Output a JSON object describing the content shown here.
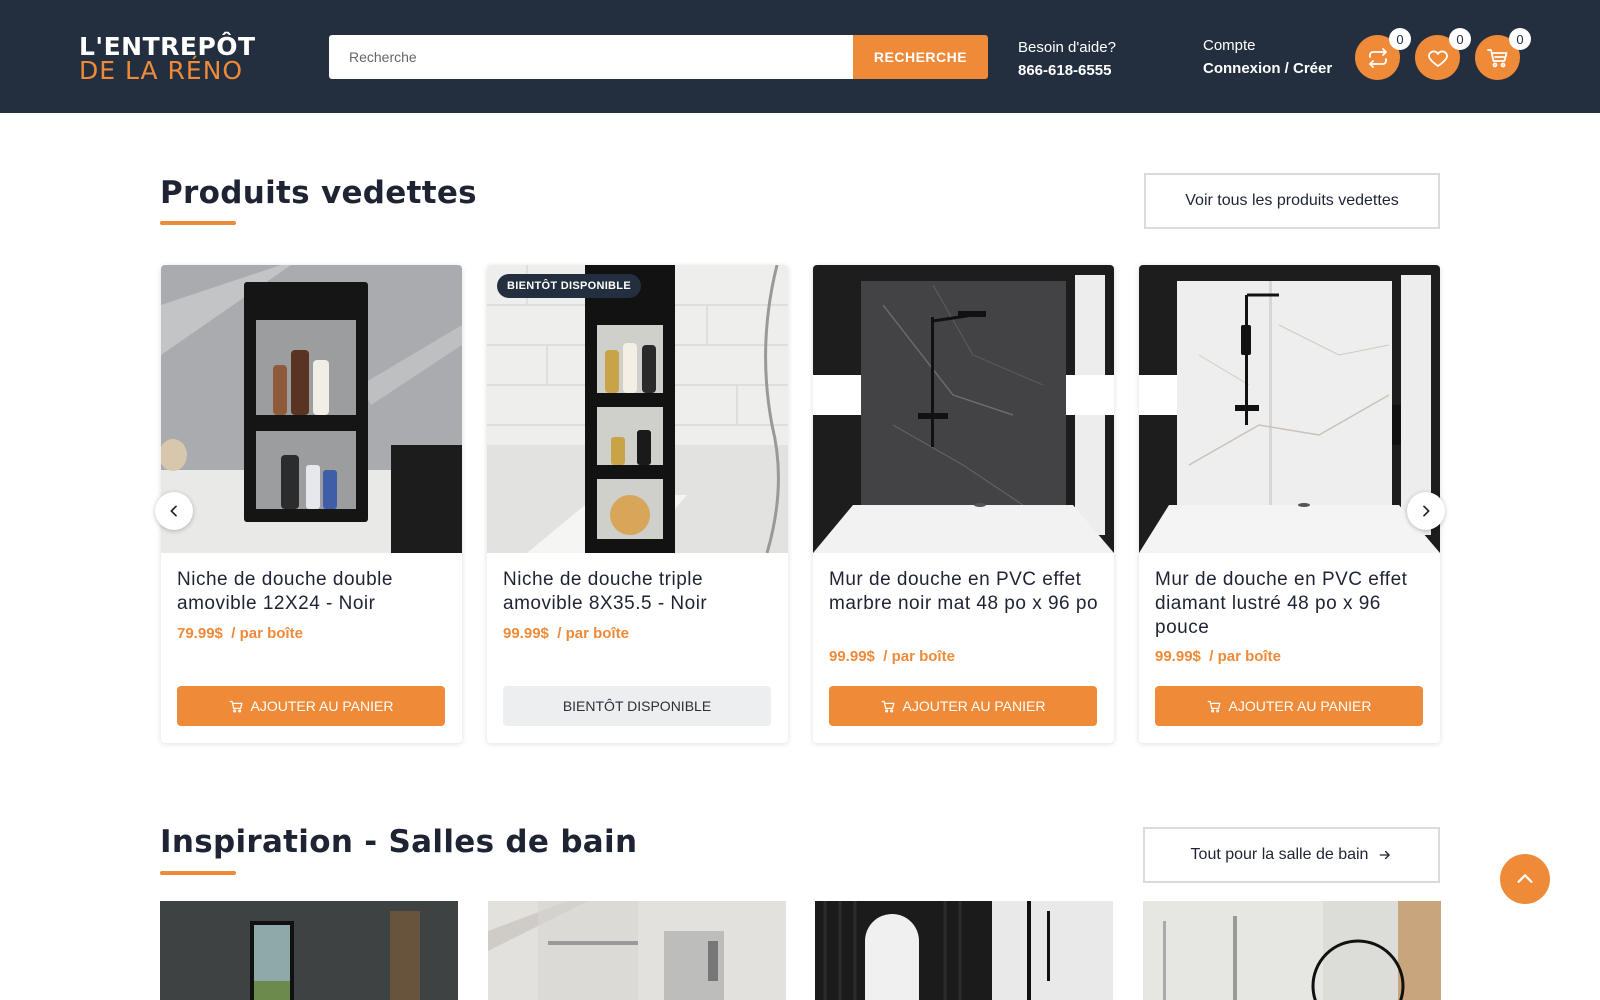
{
  "header": {
    "logo_line1": "L'ENTREPÔT",
    "logo_line2": "DE LA RÉNO",
    "search_placeholder": "Recherche",
    "search_button": "RECHERCHE",
    "help_label": "Besoin d'aide?",
    "help_phone": "866-618-6555",
    "account_label": "Compte",
    "account_links": "Connexion / Créer",
    "compare_count": "0",
    "wishlist_count": "0",
    "cart_count": "0",
    "accent_color": "#ef8a38",
    "bg_color": "#232f3e"
  },
  "featured": {
    "title": "Produits vedettes",
    "view_all": "Voir tous les produits vedettes",
    "products": [
      {
        "name": "Niche de douche double amovible 12X24 - Noir",
        "price": "79.99$",
        "unit": "/ par boîte",
        "button": "AJOUTER AU PANIER",
        "badge": ""
      },
      {
        "name": "Niche de douche triple amovible 8X35.5 - Noir",
        "price": "99.99$",
        "unit": "/ par boîte",
        "button": "BIENTÔT DISPONIBLE",
        "badge": "BIENTÔT DISPONIBLE"
      },
      {
        "name": "Mur de douche en PVC effet marbre noir mat 48 po x 96 po",
        "price": "99.99$",
        "unit": "/ par boîte",
        "button": "AJOUTER AU PANIER",
        "badge": ""
      },
      {
        "name": "Mur de douche en PVC effet diamant lustré 48 po x 96 pouce",
        "price": "99.99$",
        "unit": "/ par boîte",
        "button": "AJOUTER AU PANIER",
        "badge": ""
      }
    ]
  },
  "inspiration": {
    "title": "Inspiration - Salles de bain",
    "link": "Tout pour la salle de bain"
  },
  "icons": {
    "compare": "compare-arrows-icon",
    "wishlist": "heart-icon",
    "cart": "cart-icon",
    "prev": "chevron-left-icon",
    "next": "chevron-right-icon",
    "scroll_top": "chevron-up-icon"
  }
}
